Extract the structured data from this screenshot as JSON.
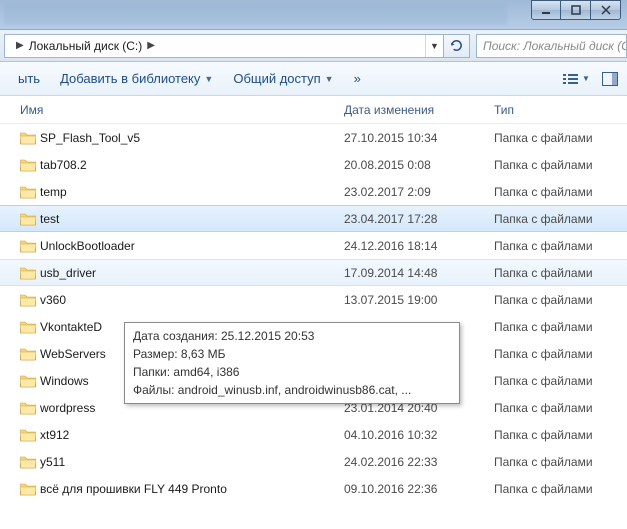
{
  "titlebar": {
    "minimize": "minimize",
    "maximize": "maximize",
    "close": "close"
  },
  "address": {
    "crumb": "Локальный диск (C:)",
    "search_placeholder": "Поиск: Локальный диск (C"
  },
  "toolbar": {
    "burn": "ыть",
    "add_to_library": "Добавить в библиотеку",
    "share": "Общий доступ",
    "overflow": "»"
  },
  "columns": {
    "name": "Имя",
    "date": "Дата изменения",
    "type": "Тип"
  },
  "type_folder": "Папка с файлами",
  "rows": [
    {
      "name": "SP_Flash_Tool_v5",
      "date": "27.10.2015 10:34",
      "selected": false,
      "hover": false
    },
    {
      "name": "tab708.2",
      "date": "20.08.2015 0:08",
      "selected": false,
      "hover": false
    },
    {
      "name": "temp",
      "date": "23.02.2017 2:09",
      "selected": false,
      "hover": false
    },
    {
      "name": "test",
      "date": "23.04.2017 17:28",
      "selected": true,
      "hover": false
    },
    {
      "name": "UnlockBootloader",
      "date": "24.12.2016 18:14",
      "selected": false,
      "hover": false
    },
    {
      "name": "usb_driver",
      "date": "17.09.2014 14:48",
      "selected": false,
      "hover": true
    },
    {
      "name": "v360",
      "date": "13.07.2015 19:00",
      "selected": false,
      "hover": false
    },
    {
      "name": "VkontakteD",
      "date": "",
      "selected": false,
      "hover": false
    },
    {
      "name": "WebServers",
      "date": "",
      "selected": false,
      "hover": false
    },
    {
      "name": "Windows",
      "date": "",
      "selected": false,
      "hover": false
    },
    {
      "name": "wordpress",
      "date": "23.01.2014 20:40",
      "selected": false,
      "hover": false
    },
    {
      "name": "xt912",
      "date": "04.10.2016 10:32",
      "selected": false,
      "hover": false
    },
    {
      "name": "y511",
      "date": "24.02.2016 22:33",
      "selected": false,
      "hover": false
    },
    {
      "name": "всё для прошивки FLY 449 Pronto",
      "date": "09.10.2016 22:36",
      "selected": false,
      "hover": false
    }
  ],
  "tooltip": {
    "line1": "Дата создания: 25.12.2015 20:53",
    "line2": "Размер: 8,63 МБ",
    "line3": "Папки: amd64, i386",
    "line4": "Файлы: android_winusb.inf, androidwinusb86.cat, ..."
  }
}
